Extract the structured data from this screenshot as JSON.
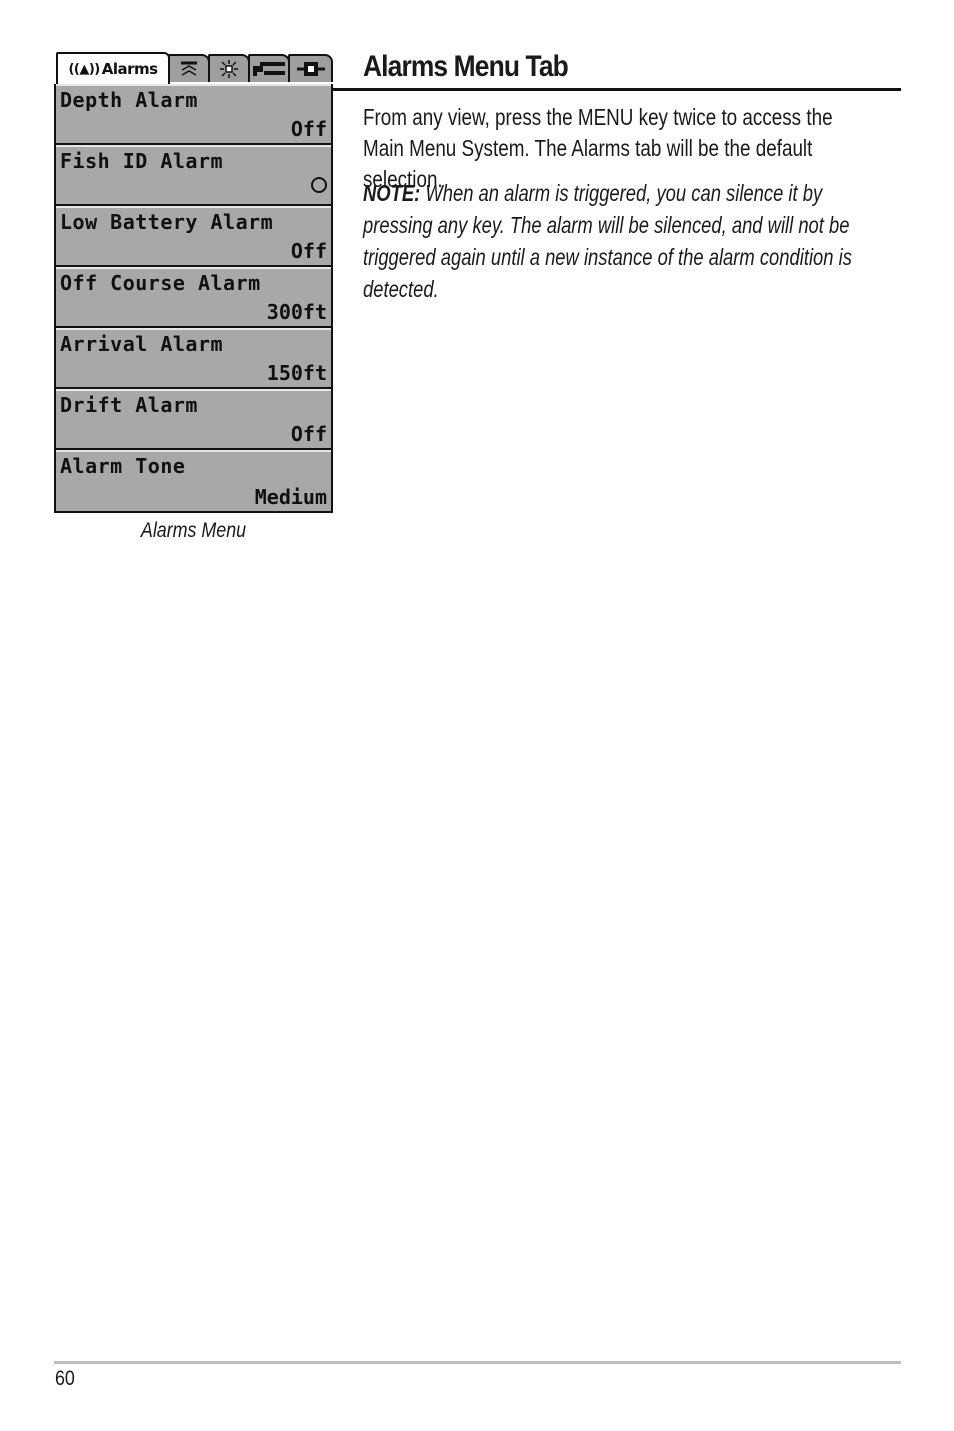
{
  "menu": {
    "tabs": [
      {
        "label": "Alarms",
        "icon": "bell-icon",
        "active": true
      },
      {
        "label": "",
        "icon": "sonar-icon"
      },
      {
        "label": "",
        "icon": "brightness-icon"
      },
      {
        "label": "",
        "icon": "setup-wrench-icon"
      },
      {
        "label": "",
        "icon": "accessories-icon"
      }
    ],
    "items": [
      {
        "label": "Depth Alarm",
        "value": "Off"
      },
      {
        "label": "Fish ID Alarm",
        "value": ""
      },
      {
        "label": "Low Battery Alarm",
        "value": "Off"
      },
      {
        "label": "Off Course Alarm",
        "value": "300ft"
      },
      {
        "label": "Arrival Alarm",
        "value": "150ft"
      },
      {
        "label": "Drift Alarm",
        "value": "Off"
      },
      {
        "label": "Alarm Tone",
        "value": "Medium"
      }
    ]
  },
  "caption": "Alarms Menu",
  "section": {
    "title": "Alarms Menu Tab",
    "paragraph": "From any view, press the MENU key twice to access the Main Menu System. The Alarms tab will be the default selection.",
    "note_label": "NOTE:",
    "note_text": " When an alarm is triggered, you can silence it by pressing any key.  The alarm will be silenced, and will not be triggered again until a new instance of the alarm condition is detected."
  },
  "footer": {
    "page_number": "60"
  }
}
